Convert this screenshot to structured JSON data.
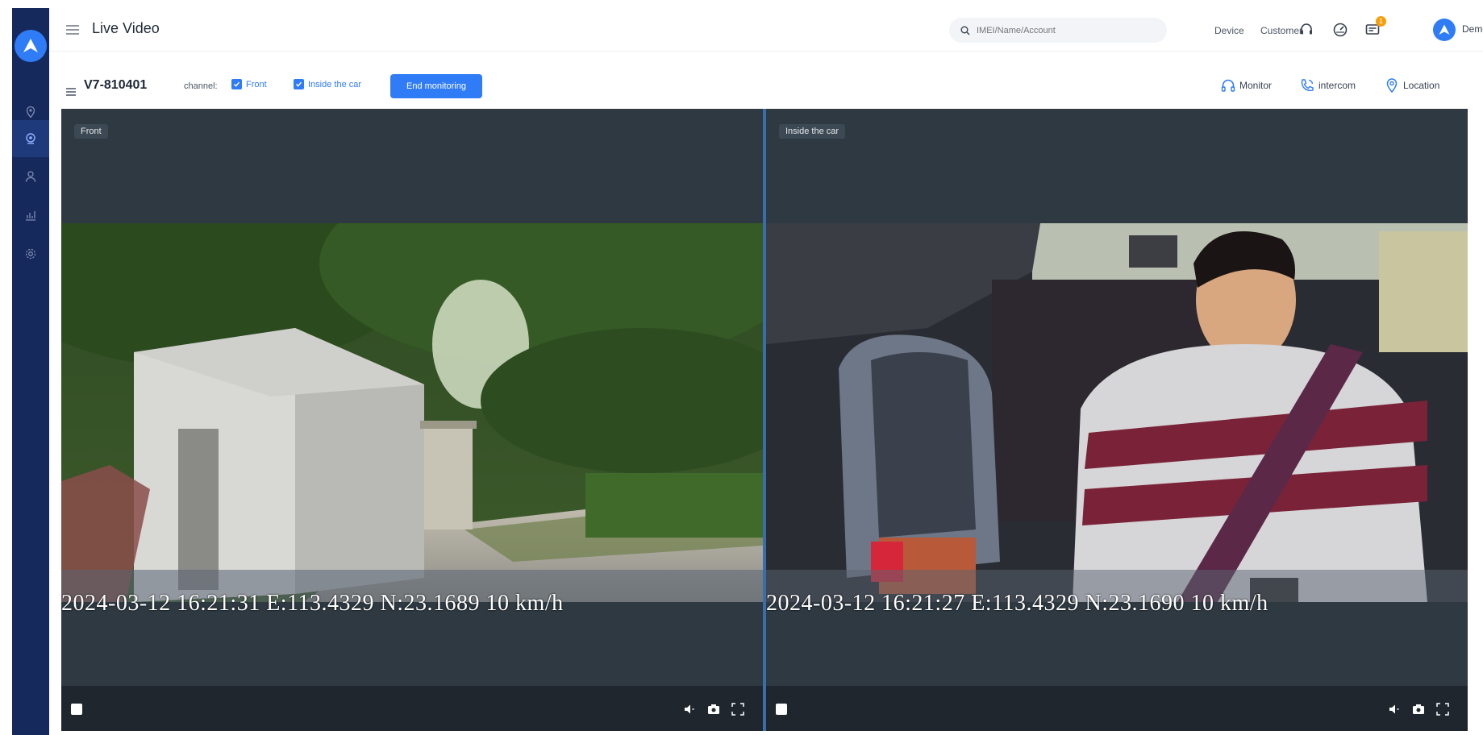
{
  "app": {
    "page_title": "Live Video",
    "search_placeholder": "IMEI/Name/Account",
    "search_tabs": [
      "Device",
      "Customer"
    ],
    "notification_count": "1",
    "user_name": "Demo",
    "accent_color": "#2f7cf6",
    "sidebar_color": "#16295c"
  },
  "sidebar": {
    "items": [
      {
        "icon": "location-pin-icon"
      },
      {
        "icon": "webcam-icon",
        "active": true
      },
      {
        "icon": "user-icon"
      },
      {
        "icon": "report-chart-icon"
      },
      {
        "icon": "gear-icon"
      }
    ]
  },
  "device": {
    "id": "V7-810401",
    "channel_label": "channel:",
    "channels": [
      {
        "label": "Front",
        "checked": true
      },
      {
        "label": "Inside the car",
        "checked": true
      }
    ],
    "end_button": "End monitoring",
    "actions": {
      "monitor": "Monitor",
      "intercom": "intercom",
      "location": "Location"
    }
  },
  "videos": [
    {
      "channel": "Front",
      "osd": "2024-03-12 16:21:31    E:113.4329 N:23.1689   10 km/h"
    },
    {
      "channel": "Inside the car",
      "osd": "2024-03-12 16:21:27    E:113.4329 N:23.1690   10 km/h"
    }
  ]
}
